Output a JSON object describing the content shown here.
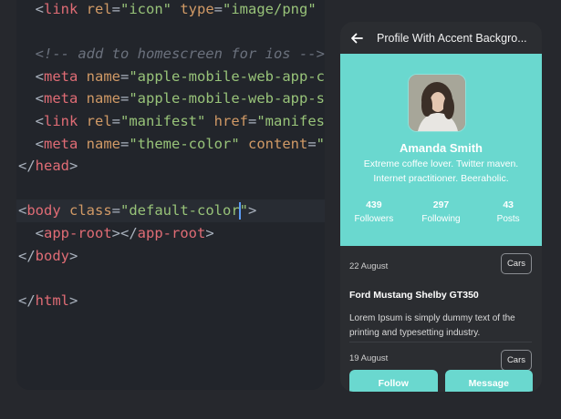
{
  "editor": {
    "lines": [
      {
        "parts": [
          [
            "punc",
            "  <"
          ],
          [
            "tag",
            "link"
          ],
          [
            "attr",
            " rel"
          ],
          [
            "punc",
            "="
          ],
          [
            "str",
            "\"icon\""
          ],
          [
            "attr",
            " type"
          ],
          [
            "punc",
            "="
          ],
          [
            "str",
            "\"image/png\""
          ],
          [
            "punc",
            " "
          ]
        ]
      },
      {
        "parts": []
      },
      {
        "parts": [
          [
            "cmt",
            "  <!-- add to homescreen for ios -->"
          ]
        ]
      },
      {
        "parts": [
          [
            "punc",
            "  <"
          ],
          [
            "tag",
            "meta"
          ],
          [
            "attr",
            " name"
          ],
          [
            "punc",
            "="
          ],
          [
            "str",
            "\"apple-mobile-web-app-ca"
          ]
        ]
      },
      {
        "parts": [
          [
            "punc",
            "  <"
          ],
          [
            "tag",
            "meta"
          ],
          [
            "attr",
            " name"
          ],
          [
            "punc",
            "="
          ],
          [
            "str",
            "\"apple-mobile-web-app-st"
          ]
        ]
      },
      {
        "parts": [
          [
            "punc",
            "  <"
          ],
          [
            "tag",
            "link"
          ],
          [
            "attr",
            " rel"
          ],
          [
            "punc",
            "="
          ],
          [
            "str",
            "\"manifest\""
          ],
          [
            "attr",
            " href"
          ],
          [
            "punc",
            "="
          ],
          [
            "str",
            "\"manifest"
          ]
        ]
      },
      {
        "parts": [
          [
            "punc",
            "  <"
          ],
          [
            "tag",
            "meta"
          ],
          [
            "attr",
            " name"
          ],
          [
            "punc",
            "="
          ],
          [
            "str",
            "\"theme-color\""
          ],
          [
            "attr",
            " content"
          ],
          [
            "punc",
            "="
          ],
          [
            "str",
            "\"#"
          ]
        ]
      },
      {
        "parts": [
          [
            "punc",
            "</"
          ],
          [
            "tag",
            "head"
          ],
          [
            "punc",
            ">"
          ]
        ]
      },
      {
        "parts": []
      },
      {
        "parts": [
          [
            "punc",
            "<"
          ],
          [
            "tag",
            "body"
          ],
          [
            "attr",
            " class"
          ],
          [
            "punc",
            "="
          ],
          [
            "str",
            "\"default-color"
          ],
          [
            "caret",
            ""
          ],
          [
            "str",
            "\""
          ],
          [
            "punc",
            ">"
          ]
        ],
        "active": true
      },
      {
        "parts": [
          [
            "punc",
            "  <"
          ],
          [
            "tag",
            "app-root"
          ],
          [
            "punc",
            "></"
          ],
          [
            "tag",
            "app-root"
          ],
          [
            "punc",
            ">"
          ]
        ]
      },
      {
        "parts": [
          [
            "punc",
            "</"
          ],
          [
            "tag",
            "body"
          ],
          [
            "punc",
            ">"
          ]
        ]
      },
      {
        "parts": []
      },
      {
        "parts": [
          [
            "punc",
            "</"
          ],
          [
            "tag",
            "html"
          ],
          [
            "punc",
            ">"
          ]
        ]
      }
    ]
  },
  "phone": {
    "title": "Profile With Accent Backgro...",
    "accent": "#6ad8cf",
    "profile": {
      "name": "Amanda Smith",
      "bio_line1": "Extreme coffee lover. Twitter maven.",
      "bio_line2": "Internet practitioner. Beeraholic."
    },
    "stats": [
      {
        "value": "439",
        "label": "Followers"
      },
      {
        "value": "297",
        "label": "Following"
      },
      {
        "value": "43",
        "label": "Posts"
      }
    ],
    "posts": [
      {
        "date": "22 August",
        "category": "Cars",
        "title": "Ford Mustang Shelby GT350",
        "body": "Lorem Ipsum is simply dummy text of the printing and typesetting industry."
      },
      {
        "date": "19 August",
        "category": "Cars"
      }
    ],
    "actions": {
      "follow": "Follow",
      "message": "Message"
    }
  }
}
